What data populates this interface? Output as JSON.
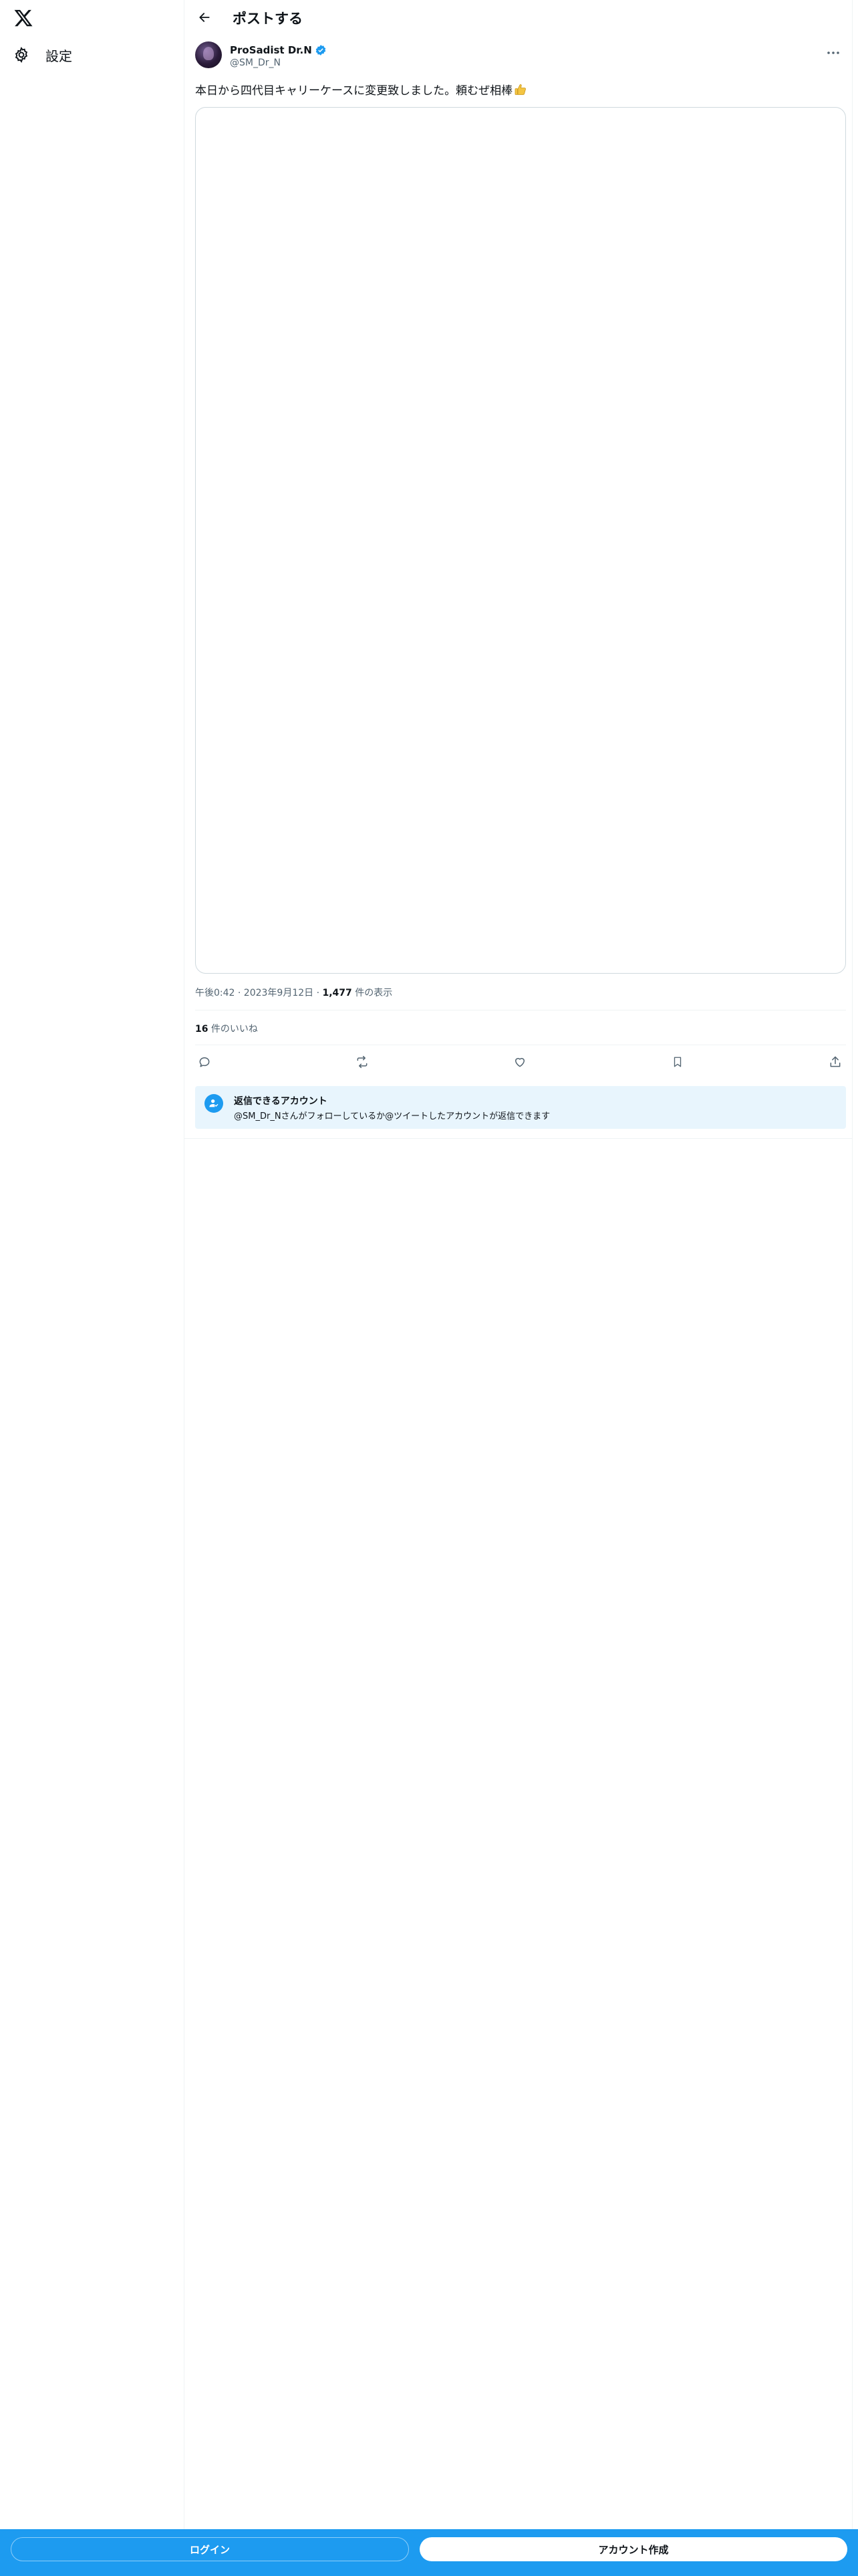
{
  "sidebar": {
    "logo_icon": "x-logo-icon",
    "settings_label": "設定",
    "settings_icon": "gear-icon"
  },
  "header": {
    "title": "ポストする",
    "back_icon": "arrow-left-icon"
  },
  "tweet": {
    "author_name": "ProSadist Dr.N",
    "author_handle": "@SM_Dr_N",
    "verified_icon": "verified-badge-icon",
    "text": "本日から四代目キャリーケースに変更致しました。頼むぜ相棒",
    "emoji_icon": "thumbs-up-emoji-icon",
    "time": "午後0:42 · 2023年9月12日 · ",
    "views_count": "1,477",
    "views_label": " 件の表示",
    "likes_count": "16",
    "likes_label": " 件のいいね"
  },
  "reply_restriction": {
    "title": "返信できるアカウント",
    "description": "@SM_Dr_Nさんがフォローしているか@ツイートしたアカウントが返信できます"
  },
  "bottom_bar": {
    "login_label": "ログイン",
    "signup_label": "アカウント作成"
  },
  "colors": {
    "accent": "#1d9bf0",
    "reply_box_bg": "#e8f5fd",
    "secondary_text": "#536471"
  }
}
